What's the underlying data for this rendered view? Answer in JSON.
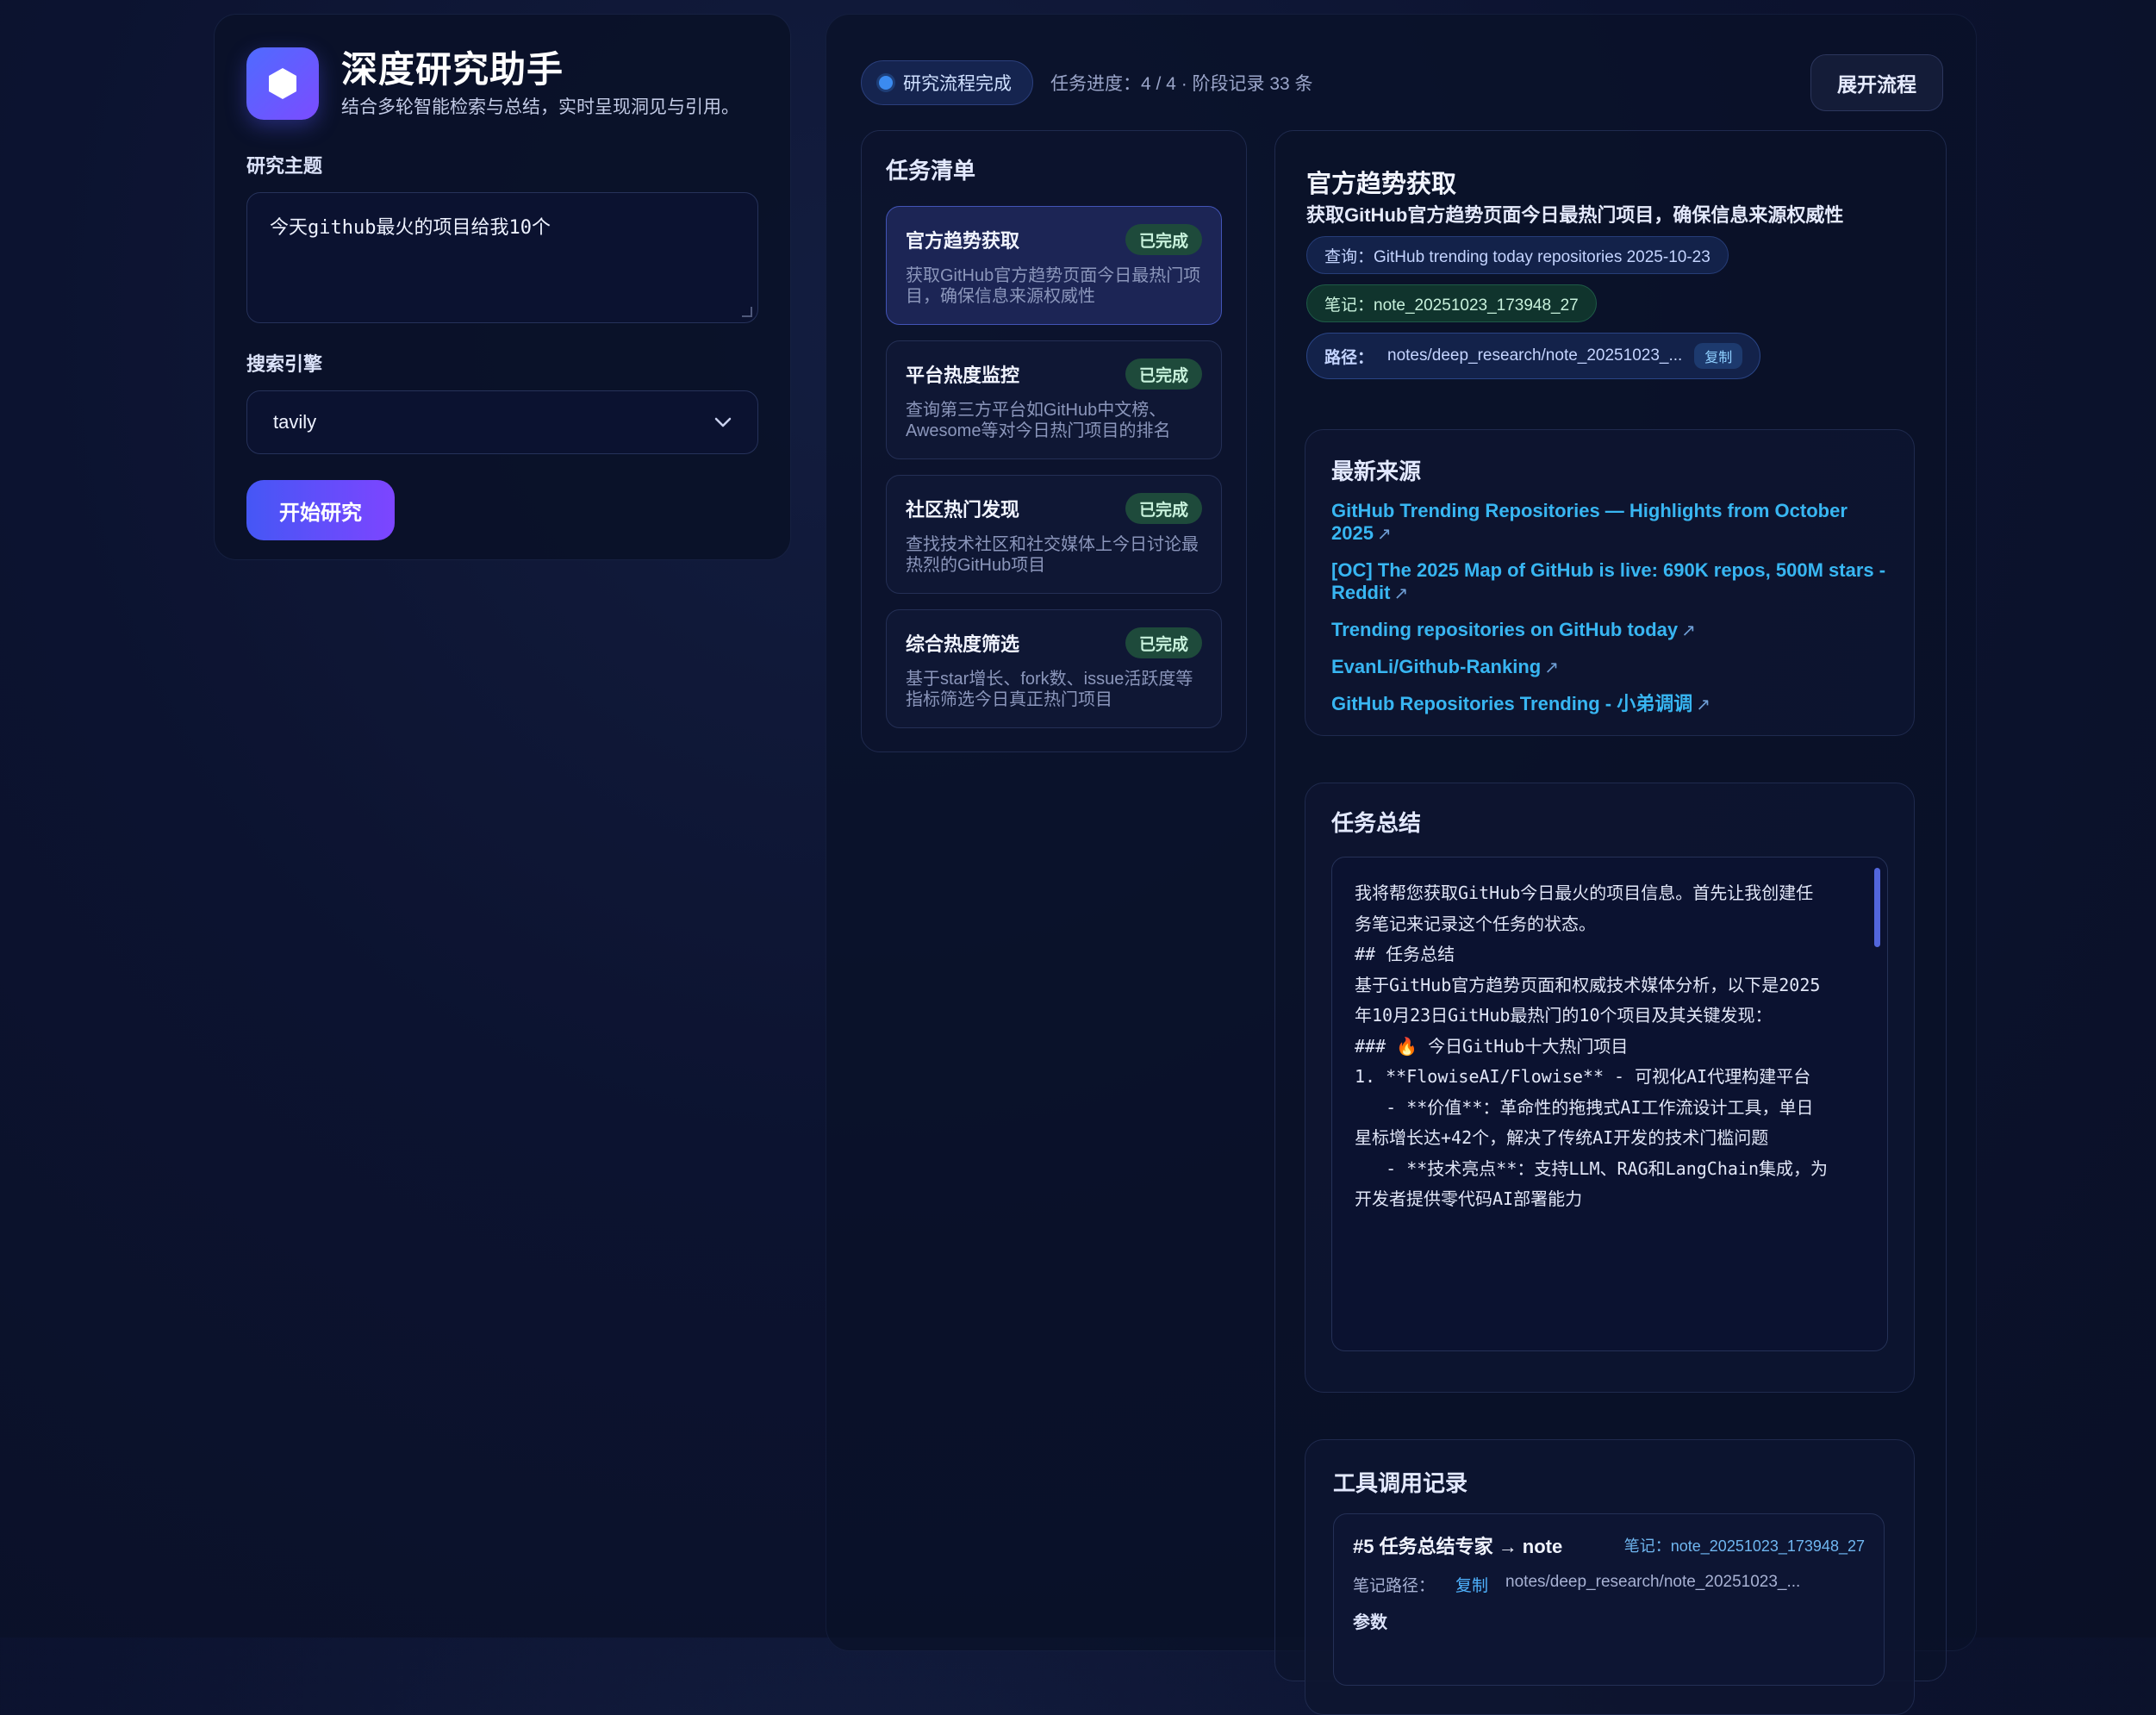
{
  "app": {
    "title": "深度研究助手",
    "subtitle": "结合多轮智能检索与总结，实时呈现洞见与引用。"
  },
  "form": {
    "topic_label": "研究主题",
    "topic_value": "今天github最火的项目给我10个",
    "engine_label": "搜索引擎",
    "engine_value": "tavily",
    "start_label": "开始研究"
  },
  "status": {
    "pill": "研究流程完成",
    "progress": "任务进度：4 / 4 · 阶段记录 33 条",
    "expand_label": "展开流程"
  },
  "tasks": {
    "heading": "任务清单",
    "items": [
      {
        "title": "官方趋势获取",
        "badge": "已完成",
        "desc": "获取GitHub官方趋势页面今日最热门项目，确保信息来源权威性"
      },
      {
        "title": "平台热度监控",
        "badge": "已完成",
        "desc": "查询第三方平台如GitHub中文榜、Awesome等对今日热门项目的排名"
      },
      {
        "title": "社区热门发现",
        "badge": "已完成",
        "desc": "查找技术社区和社交媒体上今日讨论最热烈的GitHub项目"
      },
      {
        "title": "综合热度筛选",
        "badge": "已完成",
        "desc": "基于star增长、fork数、issue活跃度等指标筛选今日真正热门项目"
      }
    ]
  },
  "detail": {
    "title": "官方趋势获取",
    "desc": "获取GitHub官方趋势页面今日最热门项目，确保信息来源权威性",
    "query_chip": "查询：GitHub trending today repositories 2025-10-23",
    "note_chip": "笔记：note_20251023_173948_27",
    "path_label": "路径：",
    "path_value": "notes/deep_research/note_20251023_...",
    "copy_label": "复制"
  },
  "sources": {
    "heading": "最新来源",
    "items": [
      {
        "text": "GitHub Trending Repositories — Highlights from October 2025"
      },
      {
        "text": "[OC] The 2025 Map of GitHub is live: 690K repos, 500M stars - Reddit"
      },
      {
        "text": "Trending repositories on GitHub today"
      },
      {
        "text": "EvanLi/Github-Ranking"
      },
      {
        "text": "GitHub Repositories Trending - 小弟调调"
      }
    ],
    "ext_icon": "↗"
  },
  "summary": {
    "heading": "任务总结",
    "lines": [
      "我将帮您获取GitHub今日最火的项目信息。首先让我创建任",
      "务笔记来记录这个任务的状态。",
      "",
      "## 任务总结",
      "",
      "基于GitHub官方趋势页面和权威技术媒体分析，以下是2025",
      "年10月23日GitHub最热门的10个项目及其关键发现：",
      "",
      "### 🔥 今日GitHub十大热门项目",
      "",
      "1. **FlowiseAI/Flowise** - 可视化AI代理构建平台",
      "   - **价值**：革命性的拖拽式AI工作流设计工具，单日",
      "星标增长达+42个，解决了传统AI开发的技术门槛问题",
      "   - **技术亮点**：支持LLM、RAG和LangChain集成，为",
      "开发者提供零代码AI部署能力"
    ]
  },
  "tools": {
    "heading": "工具调用记录",
    "item": {
      "name": "#5 任务总结专家 → note",
      "note": "笔记：note_20251023_173948_27",
      "path_label": "笔记路径：",
      "copy_label": "复制",
      "path_value": "notes/deep_research/note_20251023_...",
      "params_label": "参数"
    }
  }
}
